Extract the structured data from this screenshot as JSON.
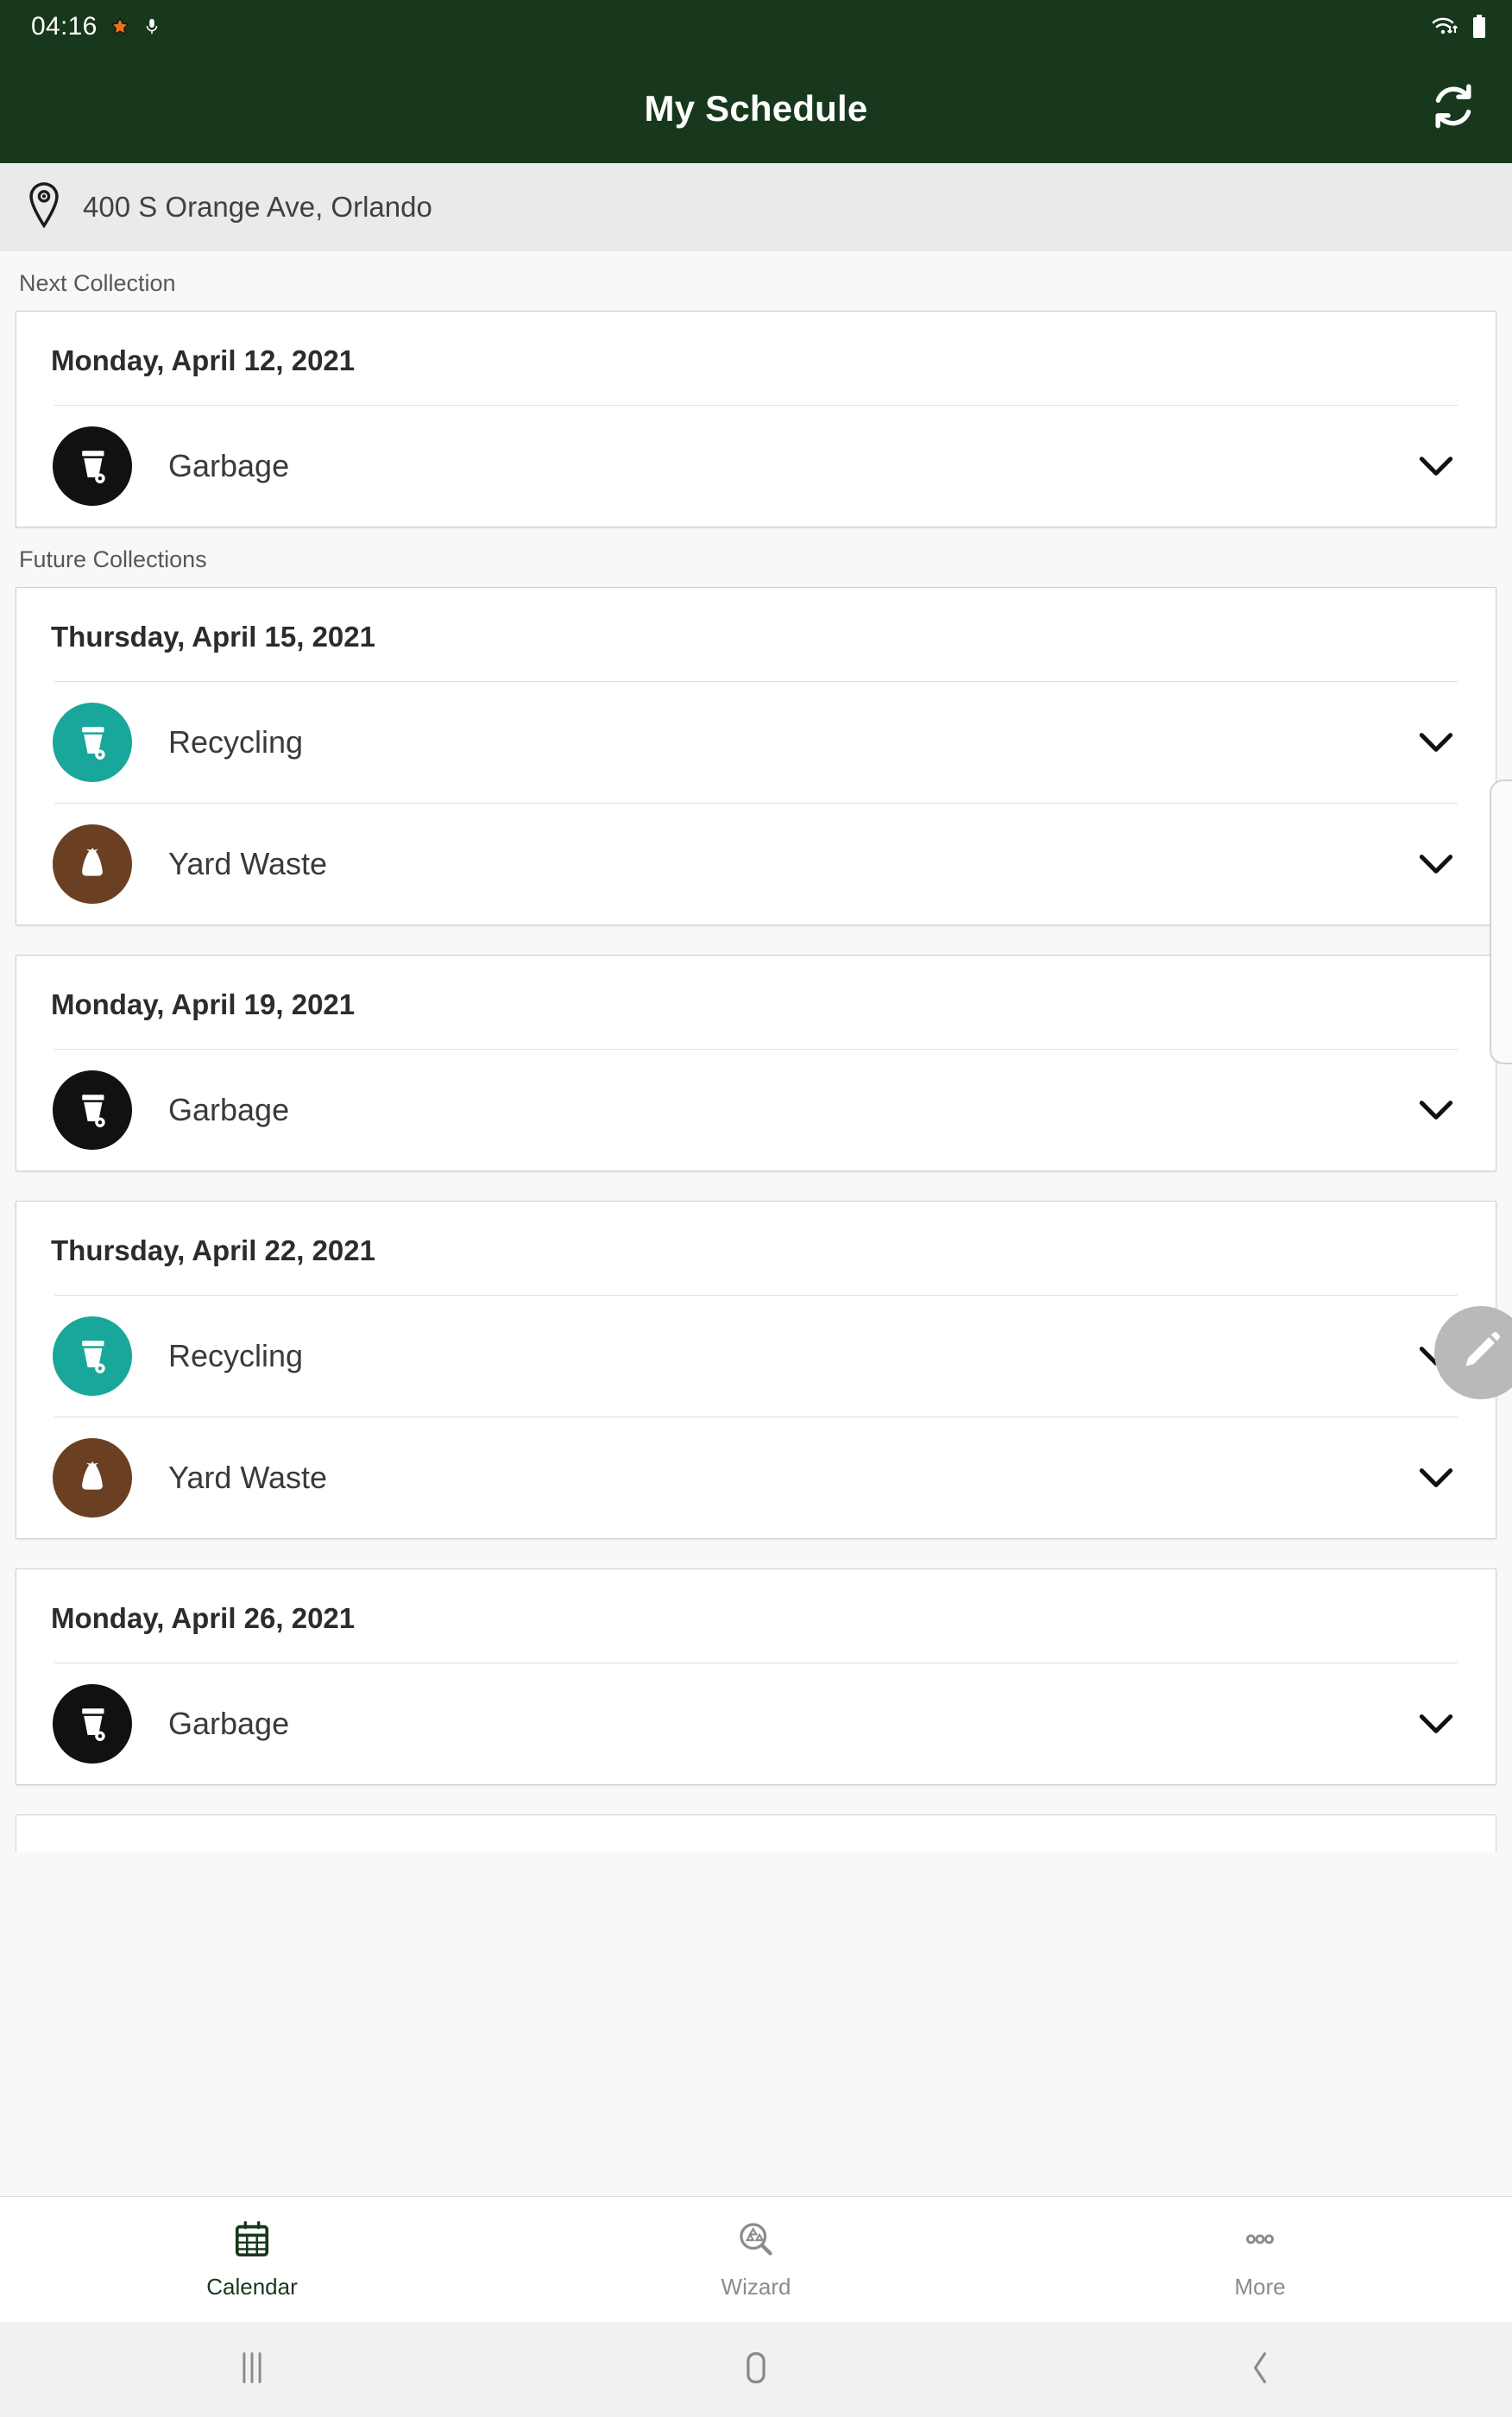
{
  "statusbar": {
    "clock": "04:16",
    "icons": [
      "star-icon",
      "microphone-icon",
      "wifi-icon",
      "battery-icon"
    ]
  },
  "appbar": {
    "title": "My Schedule",
    "refresh_label": "Refresh",
    "refresh_icon": "refresh-icon",
    "background_color": "#17381C"
  },
  "address": {
    "pin_icon": "location-pin-icon",
    "text": "400 S Orange Ave, Orlando"
  },
  "sections": [
    {
      "label": "Next Collection"
    },
    {
      "label": "Future Collections"
    }
  ],
  "colors": {
    "garbage": "#111111",
    "recycling": "#1AA79B",
    "yard_waste": "#6B4022",
    "accent_green": "#17381C"
  },
  "cards": [
    {
      "date": "Monday, April 12, 2021",
      "items": [
        {
          "name": "Garbage",
          "icon": "garbage-cart-icon",
          "color": "#111111",
          "chevron": "chevron-down-icon"
        }
      ]
    },
    {
      "date": "Thursday, April 15, 2021",
      "items": [
        {
          "name": "Recycling",
          "icon": "recycling-cart-icon",
          "color": "#1AA79B",
          "chevron": "chevron-down-icon"
        },
        {
          "name": "Yard Waste",
          "icon": "yard-waste-bag-icon",
          "color": "#6B4022",
          "chevron": "chevron-down-icon"
        }
      ]
    },
    {
      "date": "Monday, April 19, 2021",
      "items": [
        {
          "name": "Garbage",
          "icon": "garbage-cart-icon",
          "color": "#111111",
          "chevron": "chevron-down-icon"
        }
      ]
    },
    {
      "date": "Thursday, April 22, 2021",
      "items": [
        {
          "name": "Recycling",
          "icon": "recycling-cart-icon",
          "color": "#1AA79B",
          "chevron": "chevron-down-icon"
        },
        {
          "name": "Yard Waste",
          "icon": "yard-waste-bag-icon",
          "color": "#6B4022",
          "chevron": "chevron-down-icon"
        }
      ]
    },
    {
      "date": "Monday, April 26, 2021",
      "items": [
        {
          "name": "Garbage",
          "icon": "garbage-cart-icon",
          "color": "#111111",
          "chevron": "chevron-down-icon"
        }
      ]
    }
  ],
  "fab": {
    "icon": "pencil-icon",
    "label": "Edit"
  },
  "tabbar": {
    "tabs": [
      {
        "label": "Calendar",
        "icon": "calendar-icon",
        "active": true
      },
      {
        "label": "Wizard",
        "icon": "recycling-search-icon",
        "active": false
      },
      {
        "label": "More",
        "icon": "more-dots-icon",
        "active": false
      }
    ]
  },
  "navbar": {
    "buttons": [
      {
        "name": "recents",
        "icon": "recents-icon"
      },
      {
        "name": "home",
        "icon": "home-icon"
      },
      {
        "name": "back",
        "icon": "back-icon"
      }
    ]
  }
}
